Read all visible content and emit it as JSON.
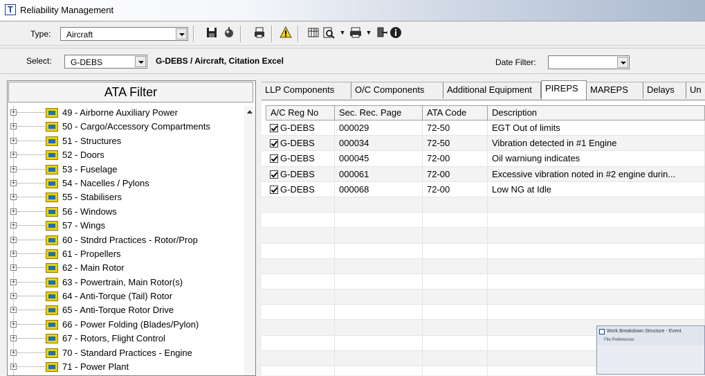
{
  "window": {
    "title": "Reliability Management",
    "icon_letter": "T"
  },
  "toolbar": {
    "type_label": "Type:",
    "type_value": "Aircraft",
    "icons": [
      "save-icon",
      "cleanup-icon",
      "print-icon",
      "warning-icon",
      "grid-icon",
      "print-preview-icon",
      "printer-icon",
      "exit-icon",
      "info-icon"
    ]
  },
  "select_bar": {
    "select_label": "Select:",
    "select_value": "G-DEBS",
    "selected_title": "G-DEBS / Aircraft, Citation Excel",
    "date_filter_label": "Date Filter:",
    "date_filter_value": ""
  },
  "ata_filter": {
    "header": "ATA Filter",
    "items": [
      "49 - Airborne Auxiliary Power",
      "50 - Cargo/Accessory Compartments",
      "51 - Structures",
      "52 - Doors",
      "53 - Fuselage",
      "54 - Nacelles / Pylons",
      "55 - Stabilisers",
      "56 - Windows",
      "57 - Wings",
      "60 - Stndrd Practices - Rotor/Prop",
      "61 - Propellers",
      "62 - Main Rotor",
      "63 - Powertrain, Main Rotor(s)",
      "64 - Anti-Torque (Tail) Rotor",
      "65 - Anti-Torque Rotor Drive",
      "66 - Power Folding (Blades/Pylon)",
      "67 - Rotors, Flight Control",
      "70 - Standard Practices - Engine",
      "71 - Power Plant"
    ]
  },
  "tabs": [
    "LLP Components",
    "O/C Components",
    "Additional Equipment",
    "PIREPS",
    "MAREPS",
    "Delays",
    "Un"
  ],
  "active_tab": "PIREPS",
  "grid": {
    "columns": [
      "A/C Reg No",
      "Sec. Rec. Page",
      "ATA Code",
      "Description"
    ],
    "rows": [
      {
        "reg": "G-DEBS",
        "page": "000029",
        "ata": "72-50",
        "desc": "EGT Out of limits",
        "checked": true
      },
      {
        "reg": "G-DEBS",
        "page": "000034",
        "ata": "72-50",
        "desc": "Vibration detected in #1 Engine",
        "checked": true
      },
      {
        "reg": "G-DEBS",
        "page": "000045",
        "ata": "72-00",
        "desc": "Oil warniung indicates",
        "checked": true
      },
      {
        "reg": "G-DEBS",
        "page": "000061",
        "ata": "72-00",
        "desc": "Excessive vibration noted in #2 engine durin...",
        "checked": true
      },
      {
        "reg": "G-DEBS",
        "page": "000068",
        "ata": "72-00",
        "desc": "Low NG at Idle",
        "checked": true
      }
    ]
  },
  "thumbnail": {
    "title": "Work Breakdown Structure - Event",
    "menu": "File   Preferences"
  }
}
